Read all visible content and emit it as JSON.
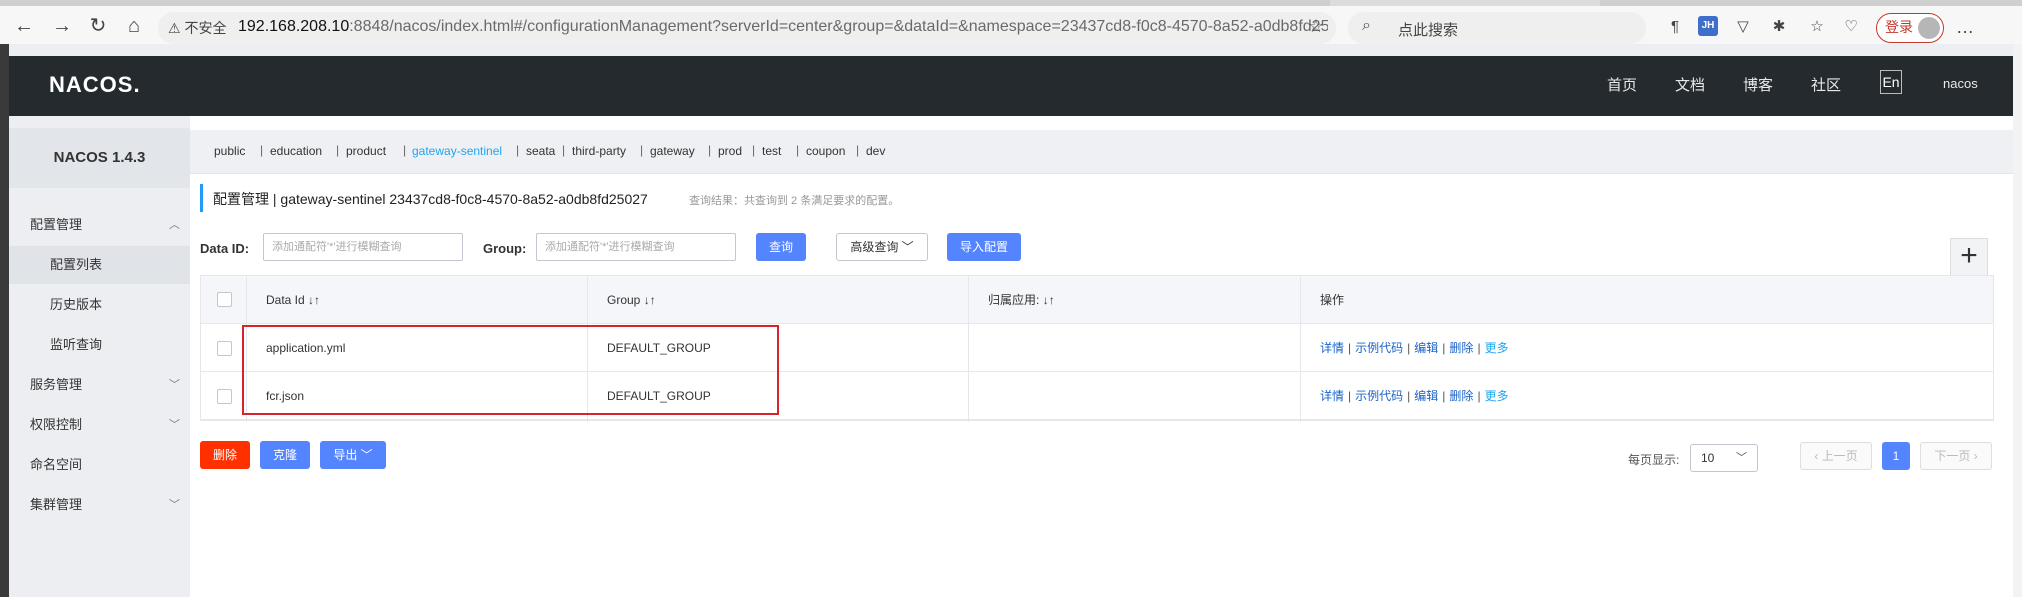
{
  "browser": {
    "insecure_label": "不安全",
    "url_host": "192.168.208.10",
    "url_rest": ":8848/nacos/index.html#/configurationManagement?serverId=center&group=&dataId=&namespace=23437cd8-f0c8-4570-8a52-a0db8fd25027&pageSize...",
    "search_placeholder": "点此搜索",
    "login_label": "登录"
  },
  "header": {
    "logo": "NACOS.",
    "nav": [
      "首页",
      "文档",
      "博客",
      "社区"
    ],
    "lang": "En",
    "user": "nacos"
  },
  "sidebar": {
    "title": "NACOS 1.4.3",
    "items": [
      {
        "label": "配置管理",
        "type": "group-open"
      },
      {
        "label": "配置列表",
        "type": "sub-active"
      },
      {
        "label": "历史版本",
        "type": "sub"
      },
      {
        "label": "监听查询",
        "type": "sub"
      },
      {
        "label": "服务管理",
        "type": "group"
      },
      {
        "label": "权限控制",
        "type": "group"
      },
      {
        "label": "命名空间",
        "type": "plain"
      },
      {
        "label": "集群管理",
        "type": "group"
      }
    ]
  },
  "namespaces": [
    "public",
    "education",
    "product",
    "gateway-sentinel",
    "seata",
    "third-party",
    "gateway",
    "prod",
    "test",
    "coupon",
    "dev"
  ],
  "selected_namespace": "gateway-sentinel",
  "page": {
    "title": "配置管理  |  gateway-sentinel  23437cd8-f0c8-4570-8a52-a0db8fd25027",
    "query_result": "查询结果：共查询到 2 条满足要求的配置。"
  },
  "filters": {
    "dataid_label": "Data ID:",
    "dataid_placeholder": "添加通配符'*'进行模糊查询",
    "group_label": "Group:",
    "group_placeholder": "添加通配符'*'进行模糊查询",
    "query_btn": "查询",
    "advanced_btn": "高级查询",
    "import_btn": "导入配置",
    "add_btn": "+"
  },
  "table": {
    "headers": [
      "Data Id",
      "Group",
      "归属应用:",
      "操作"
    ],
    "rows": [
      {
        "data_id": "application.yml",
        "group": "DEFAULT_GROUP",
        "app": ""
      },
      {
        "data_id": "fcr.json",
        "group": "DEFAULT_GROUP",
        "app": ""
      }
    ],
    "actions": [
      "详情",
      "示例代码",
      "编辑",
      "删除",
      "更多"
    ],
    "sort_glyph": "↓↑"
  },
  "bulk": {
    "delete": "删除",
    "clone": "克隆",
    "export": "导出"
  },
  "pagination": {
    "page_size_label": "每页显示:",
    "page_size": "10",
    "prev": "上一页",
    "next": "下一页",
    "current": "1"
  },
  "colors": {
    "primary": "#5584ff",
    "danger": "#ff3000",
    "link": "#1a63c9",
    "selected_ns": "#1fa5f2",
    "header_bg": "#252a2f",
    "highlight": "#d9232a"
  }
}
